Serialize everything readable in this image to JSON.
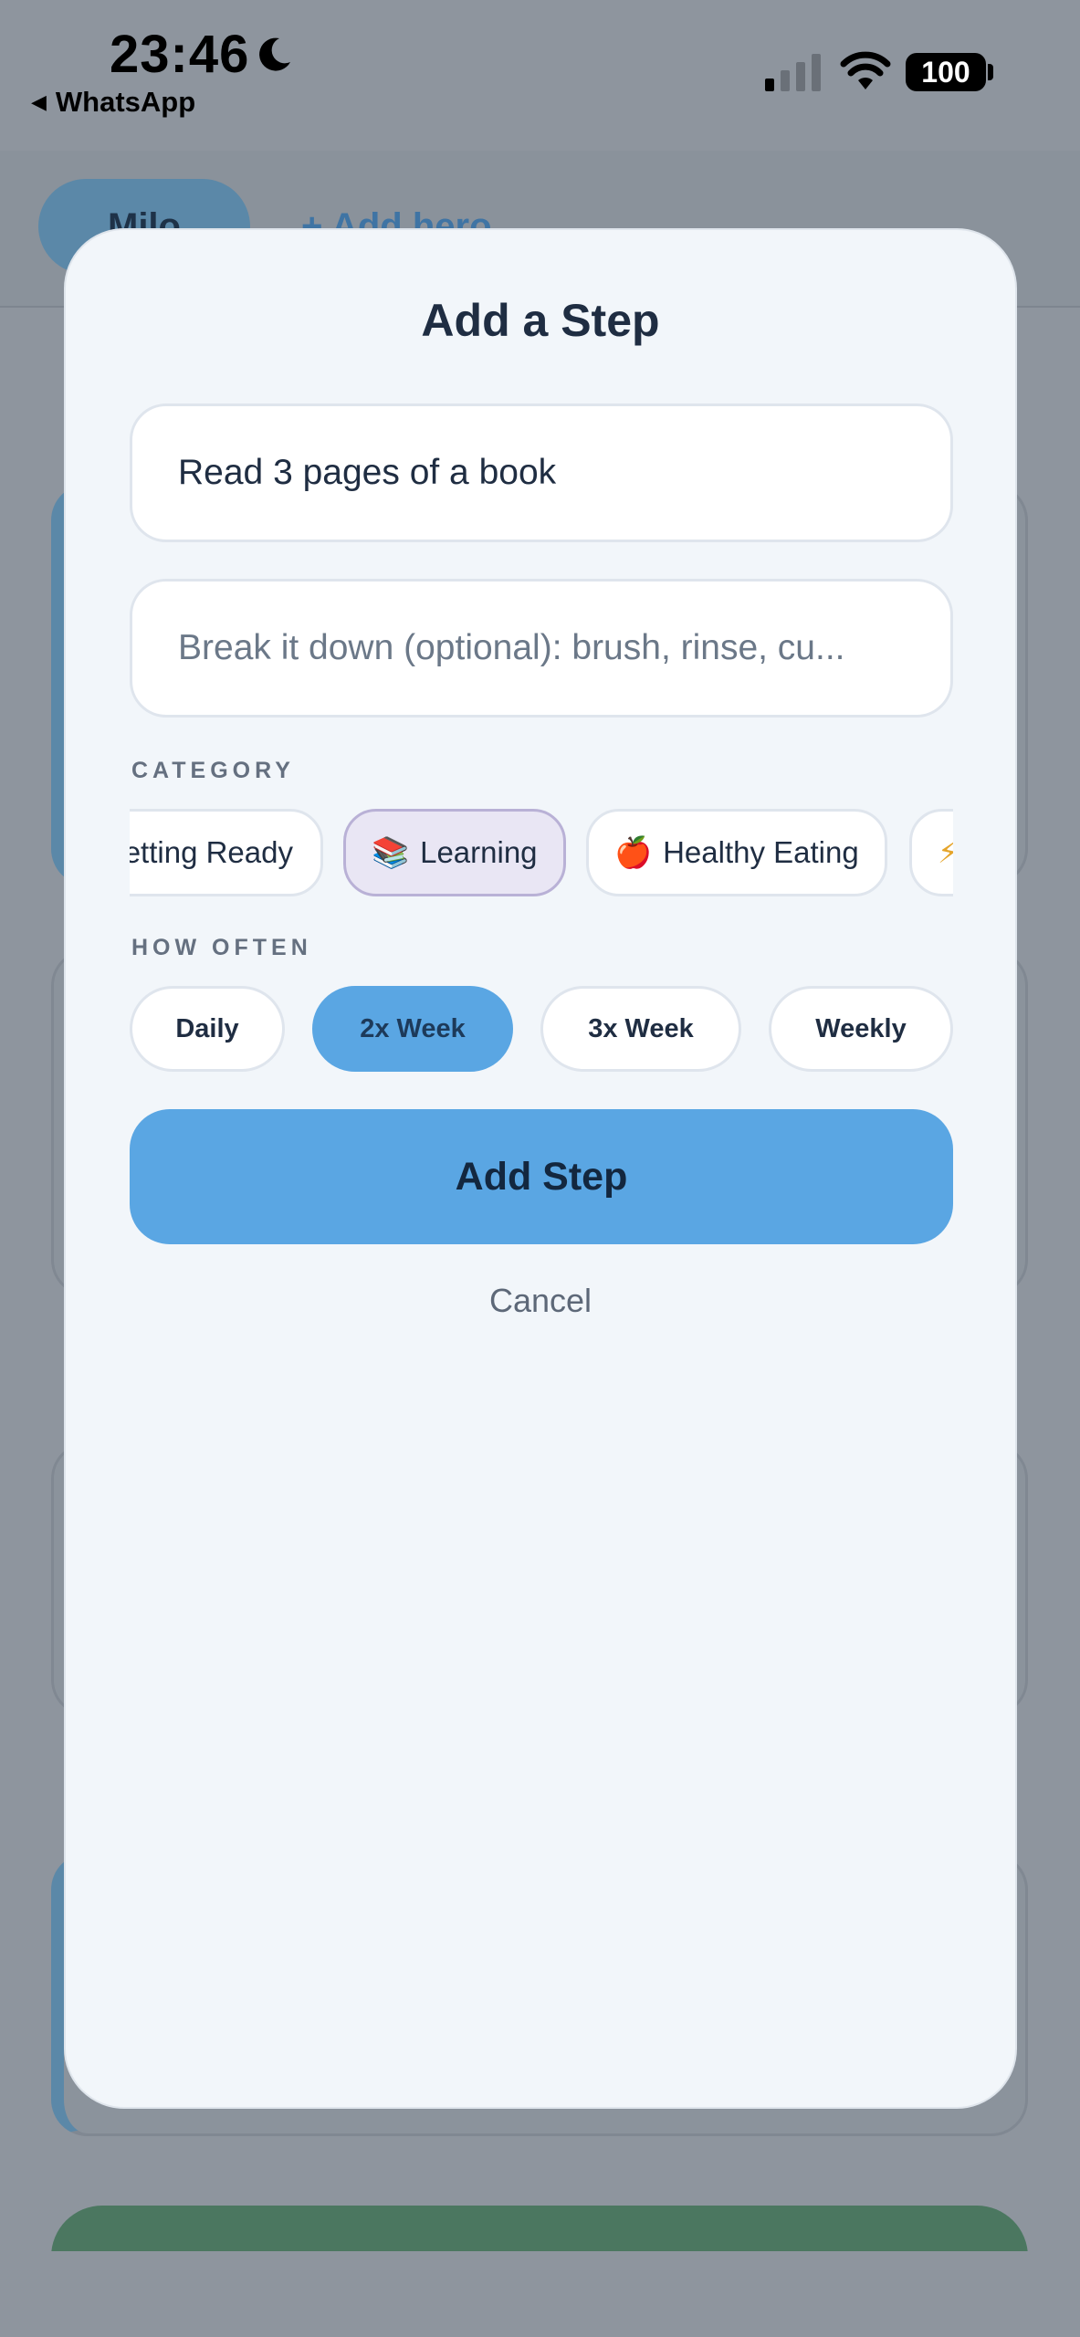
{
  "status_bar": {
    "time": "23:46",
    "back_app": "WhatsApp",
    "battery": "100"
  },
  "background": {
    "tab_active": "Milo",
    "add_hero": "+ Add hero"
  },
  "modal": {
    "title": "Add a Step",
    "step_name_value": "Read 3 pages of a book",
    "breakdown_placeholder": "Break it down (optional): brush, rinse, cu...",
    "category_label": "CATEGORY",
    "categories": [
      {
        "emoji": "",
        "label": "Getting Ready",
        "selected": false
      },
      {
        "emoji": "📚",
        "label": "Learning",
        "selected": true
      },
      {
        "emoji": "🍎",
        "label": "Healthy Eating",
        "selected": false
      },
      {
        "emoji": "⚡",
        "label": "",
        "selected": false
      }
    ],
    "frequency_label": "HOW OFTEN",
    "frequencies": [
      {
        "label": "Daily",
        "selected": false
      },
      {
        "label": "2x Week",
        "selected": true
      },
      {
        "label": "3x Week",
        "selected": false
      },
      {
        "label": "Weekly",
        "selected": false
      }
    ],
    "add_button": "Add Step",
    "cancel_button": "Cancel"
  },
  "colors": {
    "accent": "#5aa6e3",
    "selected_chip_bg": "#e9e6f4",
    "overlay": "#8e959e"
  }
}
